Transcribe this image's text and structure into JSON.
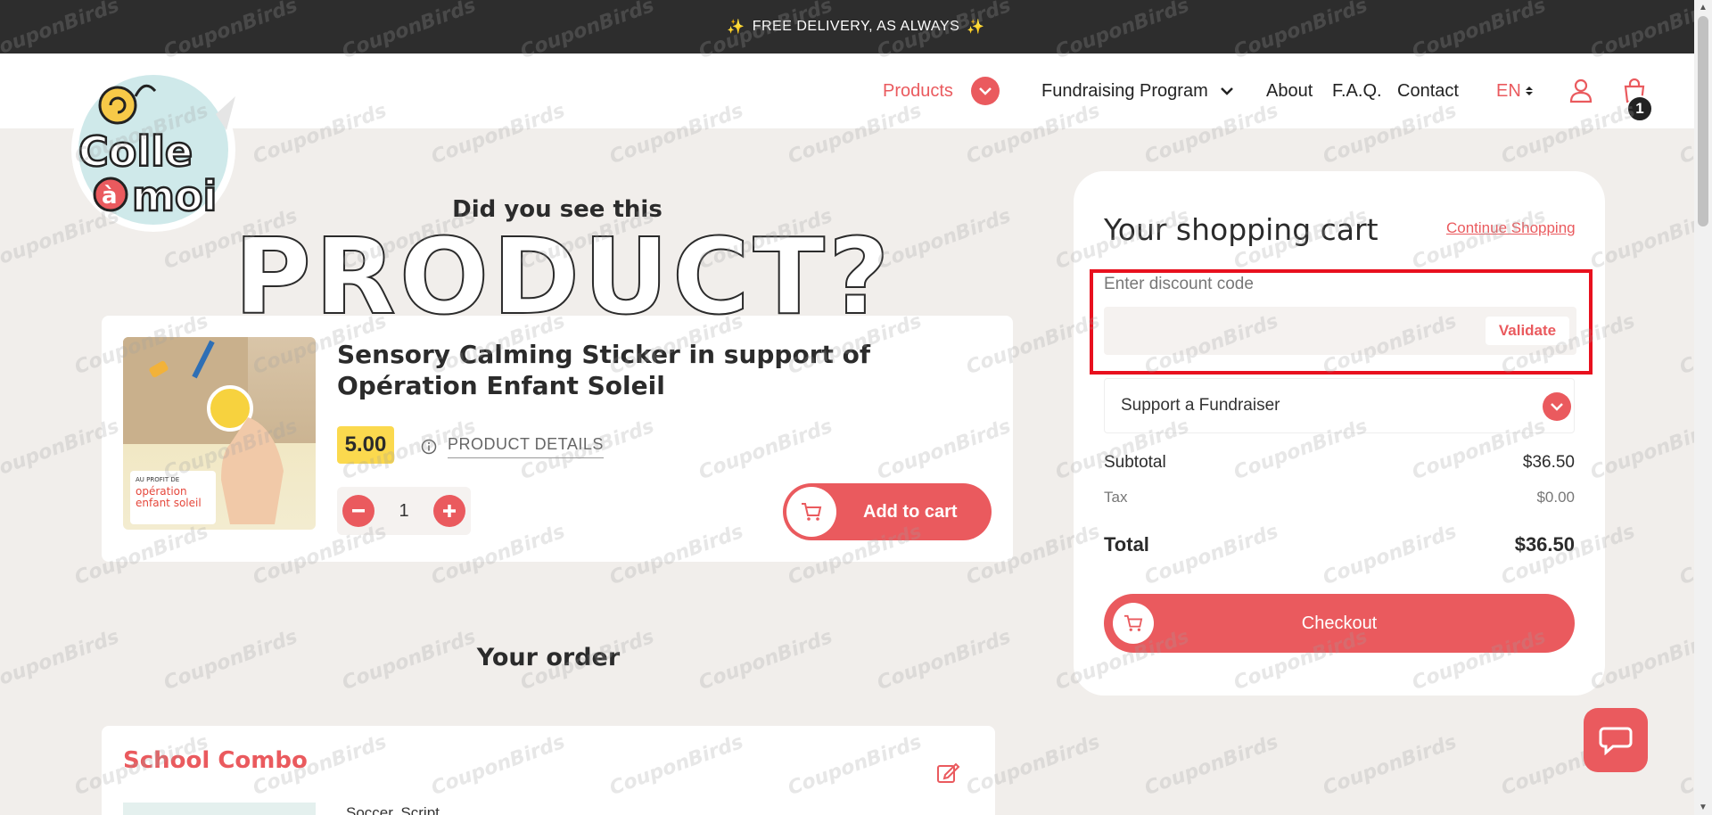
{
  "promo_bar": {
    "text": "FREE DELIVERY, AS ALWAYS",
    "spark": "✨"
  },
  "header": {
    "logo_alt": "Colle à moi",
    "nav": {
      "products": "Products",
      "fundraising": "Fundraising Program",
      "about": "About",
      "faq": "F.A.Q.",
      "contact": "Contact",
      "language": "EN"
    },
    "cart_count": "1"
  },
  "suggestion": {
    "heading": "Did you see this",
    "big_word": "PRODUCT?",
    "product": {
      "title": "Sensory Calming Sticker in support of Opération Enfant Soleil",
      "price": "5.00",
      "details_link": "PRODUCT DETAILS",
      "quantity": "1",
      "add_to_cart": "Add to cart",
      "image_caption_small": "AU PROFIT DE",
      "image_caption": "opération enfant soleil"
    }
  },
  "order": {
    "heading": "Your order",
    "item_title": "School Combo",
    "item_line": "Soccer, Script"
  },
  "cart": {
    "title": "Your shopping cart",
    "continue_shopping": "Continue Shopping",
    "discount": {
      "label": "Enter discount code",
      "value": "",
      "placeholder": "",
      "validate": "Validate"
    },
    "support_fundraiser": "Support a Fundraiser",
    "subtotal_label": "Subtotal",
    "subtotal_value": "$36.50",
    "tax_label": "Tax",
    "tax_value": "$0.00",
    "total_label": "Total",
    "total_value": "$36.50",
    "checkout": "Checkout"
  },
  "watermark": "CouponBirds",
  "colors": {
    "accent": "#ea5a5e",
    "price_badge": "#fbd94e",
    "topbar": "#2d2d2d",
    "background": "#f1eeeb",
    "highlight": "#e8101e"
  }
}
